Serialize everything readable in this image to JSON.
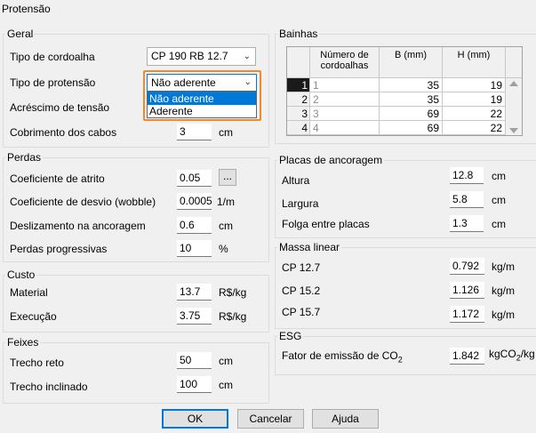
{
  "window_title": "Protensão",
  "geral": {
    "title": "Geral",
    "tipo_cordoalha_label": "Tipo de cordoalha",
    "tipo_cordoalha_value": "CP 190 RB 12.7",
    "tipo_protensao_label": "Tipo de protensão",
    "tipo_protensao_value": "Não aderente",
    "dropdown_options": [
      "Não aderente",
      "Aderente"
    ],
    "acrescimo_label": "Acréscimo de tensão",
    "cobrimento_label": "Cobrimento dos cabos",
    "cobrimento_value": "3",
    "cobrimento_unit": "cm"
  },
  "perdas": {
    "title": "Perdas",
    "atrito_label": "Coeficiente de atrito",
    "atrito_value": "0.05",
    "atrito_btn": "...",
    "desvio_label": "Coeficiente de desvio (wobble)",
    "desvio_value": "0.0005",
    "desvio_unit": "1/m",
    "desliz_label": "Deslizamento na ancoragem",
    "desliz_value": "0.6",
    "desliz_unit": "cm",
    "progr_label": "Perdas progressivas",
    "progr_value": "10",
    "progr_unit": "%"
  },
  "custo": {
    "title": "Custo",
    "material_label": "Material",
    "material_value": "13.7",
    "material_unit": "R$/kg",
    "execucao_label": "Execução",
    "execucao_value": "3.75",
    "execucao_unit": "R$/kg"
  },
  "feixes": {
    "title": "Feixes",
    "reto_label": "Trecho reto",
    "reto_value": "50",
    "reto_unit": "cm",
    "incl_label": "Trecho inclinado",
    "incl_value": "100",
    "incl_unit": "cm"
  },
  "bainhas": {
    "title": "Bainhas",
    "headers": {
      "num": "Número de cordoalhas",
      "b": "B (mm)",
      "h": "H (mm)"
    },
    "rows": [
      {
        "idx": "1",
        "num": "1",
        "b": "35",
        "h": "19"
      },
      {
        "idx": "2",
        "num": "2",
        "b": "35",
        "h": "19"
      },
      {
        "idx": "3",
        "num": "3",
        "b": "69",
        "h": "22"
      },
      {
        "idx": "4",
        "num": "4",
        "b": "69",
        "h": "22"
      }
    ]
  },
  "placas": {
    "title": "Placas de ancoragem",
    "altura_label": "Altura",
    "altura_value": "12.8",
    "altura_unit": "cm",
    "largura_label": "Largura",
    "largura_value": "5.8",
    "largura_unit": "cm",
    "folga_label": "Folga entre placas",
    "folga_value": "1.3",
    "folga_unit": "cm"
  },
  "massa": {
    "title": "Massa linear",
    "cp127_label": "CP 12.7",
    "cp127_value": "0.792",
    "cp152_label": "CP 15.2",
    "cp152_value": "1.126",
    "cp157_label": "CP 15.7",
    "cp157_value": "1.172",
    "unit": "kg/m"
  },
  "esg": {
    "title": "ESG",
    "fator_label_pre": "Fator de emissão de CO",
    "fator_label_sub": "2",
    "fator_value": "1.842",
    "unit_pre": "kgCO",
    "unit_sub": "2",
    "unit_post": "/kg"
  },
  "buttons": {
    "ok": "OK",
    "cancel": "Cancelar",
    "help": "Ajuda"
  },
  "colors": {
    "highlight": "#0078d7",
    "focus_ring": "#f08a2c"
  }
}
